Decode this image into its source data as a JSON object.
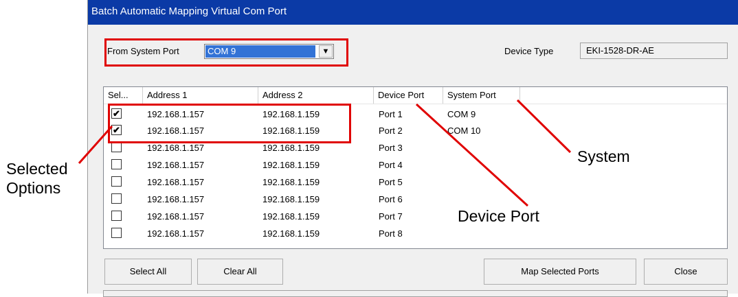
{
  "window": {
    "title": "Batch Automatic Mapping Virtual Com Port"
  },
  "from_port": {
    "label": "From System Port",
    "value": "COM 9",
    "arrow": "▼"
  },
  "device_type": {
    "label": "Device Type",
    "value": "EKI-1528-DR-AE"
  },
  "columns": [
    "Sel...",
    "Address 1",
    "Address 2",
    "Device Port",
    "System Port"
  ],
  "rows": [
    {
      "checked": true,
      "check_mark": "✔",
      "address1": "192.168.1.157",
      "address2": "192.168.1.159",
      "device_port": "Port 1",
      "system_port": "COM 9"
    },
    {
      "checked": true,
      "check_mark": "✔",
      "address1": "192.168.1.157",
      "address2": "192.168.1.159",
      "device_port": "Port 2",
      "system_port": "COM 10"
    },
    {
      "checked": false,
      "check_mark": "",
      "address1": "192.168.1.157",
      "address2": "192.168.1.159",
      "device_port": "Port 3",
      "system_port": ""
    },
    {
      "checked": false,
      "check_mark": "",
      "address1": "192.168.1.157",
      "address2": "192.168.1.159",
      "device_port": "Port 4",
      "system_port": ""
    },
    {
      "checked": false,
      "check_mark": "",
      "address1": "192.168.1.157",
      "address2": "192.168.1.159",
      "device_port": "Port 5",
      "system_port": ""
    },
    {
      "checked": false,
      "check_mark": "",
      "address1": "192.168.1.157",
      "address2": "192.168.1.159",
      "device_port": "Port 6",
      "system_port": ""
    },
    {
      "checked": false,
      "check_mark": "",
      "address1": "192.168.1.157",
      "address2": "192.168.1.159",
      "device_port": "Port 7",
      "system_port": ""
    },
    {
      "checked": false,
      "check_mark": "",
      "address1": "192.168.1.157",
      "address2": "192.168.1.159",
      "device_port": "Port 8",
      "system_port": ""
    }
  ],
  "buttons": {
    "select_all": "Select All",
    "clear_all": "Clear All",
    "map_selected": "Map Selected Ports",
    "close": "Close"
  },
  "annotations": {
    "selected_line1": "Selected",
    "selected_line2": "Options",
    "system": "System",
    "device_port": "Device Port"
  },
  "colors": {
    "title_bar": "#0b3aa6",
    "selection": "#3373d6",
    "highlight_box": "#e00000"
  }
}
